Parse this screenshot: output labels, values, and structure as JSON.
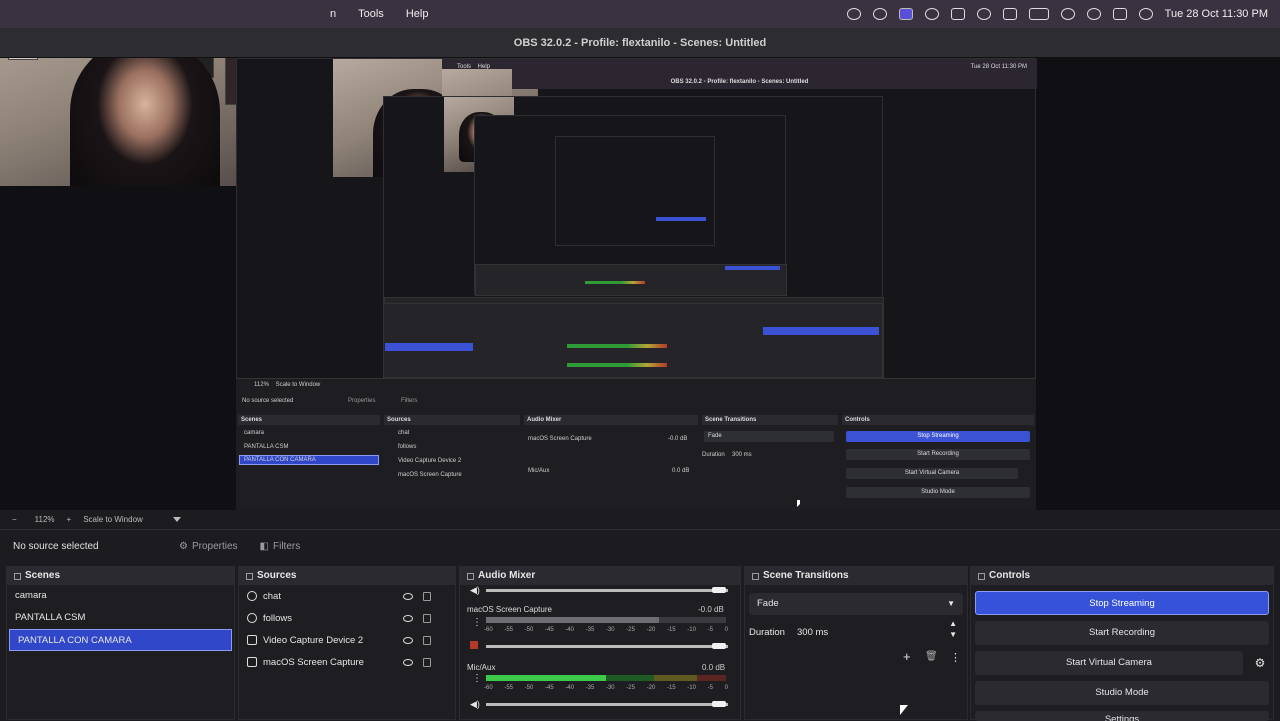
{
  "menubar": {
    "items": [
      "n",
      "Tools",
      "Help"
    ],
    "clock": "Tue 28 Oct 11:30 PM"
  },
  "window": {
    "title": "OBS 32.0.2 - Profile: flextanilo - Scenes: Untitled"
  },
  "inner_preview": {
    "title": "OBS 32.0.2 - Profile: flextanilo - Scenes: Untitled",
    "clock": "Tue 28 Oct 11:30 PM",
    "no_source": "No source selected",
    "properties": "Properties",
    "filters": "Filters",
    "zoom": "112%",
    "scale": "Scale to Window",
    "docks": [
      "Scenes",
      "Sources",
      "Audio Mixer",
      "Scene Transitions",
      "Controls"
    ],
    "scenes": [
      "camara",
      "PANTALLA CSM",
      "PANTALLA CON CAMARA"
    ],
    "sources": [
      "chat",
      "follows",
      "Video Capture Device 2",
      "macOS Screen Capture"
    ],
    "mixer": [
      "macOS Screen Capture",
      "Mic/Aux"
    ],
    "mixer_db": [
      "-0.0 dB",
      "0.0 dB"
    ],
    "transition": "Fade",
    "duration_label": "Duration",
    "duration": "300 ms",
    "controls": [
      "Stop Streaming",
      "Start Recording",
      "Start Virtual Camera",
      "Studio Mode"
    ]
  },
  "toolbar": {
    "minus": "−",
    "zoom": "112%",
    "plus": "+",
    "scale_mode": "Scale to Window"
  },
  "status": {
    "no_source": "No source selected",
    "properties": "Properties",
    "filters": "Filters"
  },
  "scenes": {
    "header": "Scenes",
    "items": [
      "camara",
      "PANTALLA CSM",
      "PANTALLA CON CAMARA"
    ],
    "selected_index": 2
  },
  "sources": {
    "header": "Sources",
    "items": [
      {
        "label": "chat",
        "icon": "globe-icon"
      },
      {
        "label": "follows",
        "icon": "globe-icon"
      },
      {
        "label": "Video Capture Device 2",
        "icon": "camera-icon"
      },
      {
        "label": "macOS Screen Capture",
        "icon": "monitor-icon"
      }
    ]
  },
  "audio_mixer": {
    "header": "Audio Mixer",
    "channels": [
      {
        "name": "macOS Screen Capture",
        "db": "-0.0 dB",
        "level": 0.72
      },
      {
        "name": "Mic/Aux",
        "db": "0.0 dB",
        "level": 0.5
      }
    ],
    "scale": [
      "-60",
      "-55",
      "-50",
      "-45",
      "-40",
      "-35",
      "-30",
      "-25",
      "-20",
      "-15",
      "-10",
      "-5",
      "0"
    ],
    "colors": {
      "green": "#2e9b36",
      "yellow": "#b3a636",
      "red": "#b33a2a"
    }
  },
  "transitions": {
    "header": "Scene Transitions",
    "selected": "Fade",
    "duration_label": "Duration",
    "duration": "300 ms",
    "add": "+",
    "remove": "🗑",
    "more": "⋮"
  },
  "controls": {
    "header": "Controls",
    "buttons": [
      "Stop Streaming",
      "Start Recording",
      "Start Virtual Camera",
      "Studio Mode",
      "Settings"
    ],
    "accent": "#3552d8"
  }
}
